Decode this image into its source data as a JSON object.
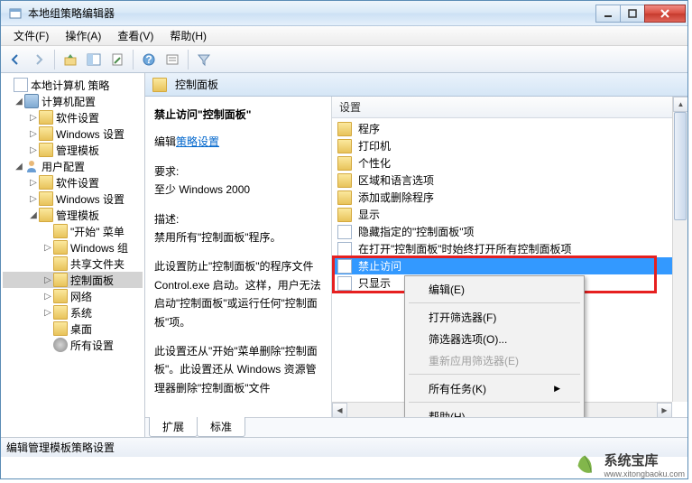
{
  "window": {
    "title": "本地组策略编辑器"
  },
  "menu": {
    "file": "文件(F)",
    "action": "操作(A)",
    "view": "查看(V)",
    "help": "帮助(H)"
  },
  "tree": {
    "root": "本地计算机 策略",
    "computer": "计算机配置",
    "comp_soft": "软件设置",
    "comp_win": "Windows 设置",
    "comp_admin": "管理模板",
    "user": "用户配置",
    "user_soft": "软件设置",
    "user_win": "Windows 设置",
    "user_admin": "管理模板",
    "start_menu": "\"开始\" 菜单",
    "win_comp": "Windows 组",
    "shared": "共享文件夹",
    "control_panel": "控制面板",
    "network": "网络",
    "system": "系统",
    "desktop": "桌面",
    "all_settings": "所有设置"
  },
  "breadcrumb": {
    "label": "控制面板"
  },
  "policy": {
    "title": "禁止访问\"控制面板\"",
    "edit_prefix": "编辑",
    "edit_link": "策略设置",
    "req_label": "要求:",
    "req_value": "至少 Windows 2000",
    "desc_label": "描述:",
    "desc_line1": "禁用所有\"控制面板\"程序。",
    "desc_p2": "此设置防止\"控制面板\"的程序文件 Control.exe 启动。这样，用户无法启动\"控制面板\"或运行任何\"控制面板\"项。",
    "desc_p3": "此设置还从\"开始\"菜单删除\"控制面板\"。此设置还从 Windows 资源管理器删除\"控制面板\"文件"
  },
  "list": {
    "header": "设置",
    "items": {
      "i0": "程序",
      "i1": "打印机",
      "i2": "个性化",
      "i3": "区域和语言选项",
      "i4": "添加或删除程序",
      "i5": "显示",
      "i6": "隐藏指定的\"控制面板\"项",
      "i7": "在打开\"控制面板\"时始终打开所有控制面板项",
      "i8": "禁止访问",
      "i9": "只显示"
    }
  },
  "context": {
    "edit": "编辑(E)",
    "filter_on": "打开筛选器(F)",
    "filter_opts": "筛选器选项(O)...",
    "reapply": "重新应用筛选器(E)",
    "all_tasks": "所有任务(K)",
    "help": "帮助(H)"
  },
  "tabs": {
    "extended": "扩展",
    "standard": "标准"
  },
  "status": {
    "text": "编辑管理模板策略设置"
  },
  "watermark": {
    "cn": "系统宝库",
    "en": "www.xitongbaoku.com"
  }
}
